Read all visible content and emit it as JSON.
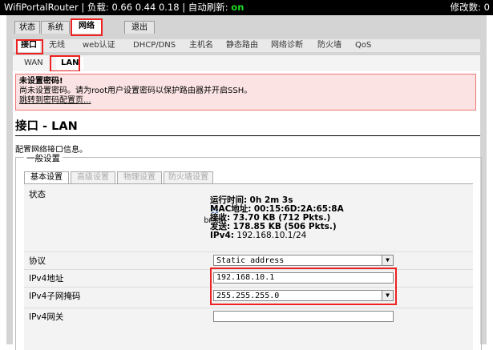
{
  "topbar": {
    "hostname": "WifiPortalRouter",
    "load_label": "负载:",
    "load_value": "0.66 0.44 0.18",
    "autorefresh_label": "自动刷新:",
    "autorefresh_value": "on",
    "changes_label": "修改数:",
    "changes_value": "0"
  },
  "tabs_main": [
    {
      "label": "状态"
    },
    {
      "label": "系统"
    },
    {
      "label": "网络"
    },
    {
      "label": "退出"
    }
  ],
  "tabs_sub": [
    {
      "label": "接口"
    },
    {
      "label": "无线"
    },
    {
      "label": "web认证"
    },
    {
      "label": "DHCP/DNS"
    },
    {
      "label": "主机名"
    },
    {
      "label": "静态路由"
    },
    {
      "label": "网络诊断"
    },
    {
      "label": "防火墙"
    },
    {
      "label": "QoS"
    }
  ],
  "tabs_iface": [
    {
      "label": "WAN"
    },
    {
      "label": "LAN"
    }
  ],
  "warning": {
    "title": "未设置密码!",
    "text": "尚未设置密码。请为root用户设置密码以保护路由器并开启SSH。",
    "link": "跳转到密码配置页..."
  },
  "page": {
    "title": "接口 - LAN",
    "description": "配置网络接口信息。"
  },
  "general": {
    "legend": "一般设置",
    "tabs": [
      {
        "label": "基本设置"
      },
      {
        "label": "高级设置"
      },
      {
        "label": "物理设置"
      },
      {
        "label": "防火墙设置"
      }
    ]
  },
  "status": {
    "label": "状态",
    "iface_name": "br-lan",
    "uptime_label": "运行时间:",
    "uptime_value": "0h 2m 3s",
    "mac_label": "MAC地址:",
    "mac_value": "00:15:6D:2A:65:8A",
    "rx_label": "接收:",
    "rx_value": "73.70 KB (712 Pkts.)",
    "tx_label": "发送:",
    "tx_value": "178.85 KB (506 Pkts.)",
    "ipv4_label": "IPv4:",
    "ipv4_value": "192.168.10.1/24"
  },
  "fields": {
    "protocol_label": "协议",
    "protocol_value": "Static address",
    "ipv4_addr_label": "IPv4地址",
    "ipv4_addr_value": "192.168.10.1",
    "netmask_label": "IPv4子网掩码",
    "netmask_value": "255.255.255.0",
    "gateway_label": "IPv4网关",
    "gateway_value": ""
  },
  "colors": {
    "accent_red": "#ee2222",
    "autorefresh_on": "#22dd22"
  }
}
